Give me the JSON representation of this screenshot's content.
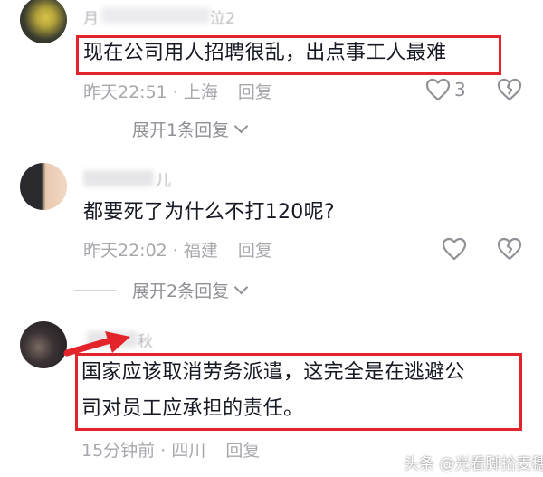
{
  "comments": [
    {
      "name_fragment": "月",
      "name_fragment_2": "泣2",
      "content": "现在公司用人招聘很乱，出点事工人最难",
      "time": "昨天22:51",
      "location": "上海",
      "reply_label": "回复",
      "likes": "3",
      "expand_label": "展开1条回复"
    },
    {
      "name_fragment": "儿",
      "content": "都要死了为什么不打120呢?",
      "time": "昨天22:02",
      "location": "福建",
      "reply_label": "回复",
      "expand_label": "展开2条回复"
    },
    {
      "name_fragment": "秋",
      "content_line1": "国家应该取消劳务派遣，这完全是在逃避公",
      "content_line2": "司对员工应承担的责任。",
      "time": "15分钟前",
      "location": "四川",
      "reply_label": "回复"
    }
  ],
  "separator": " · ",
  "watermark": "头条 @光看脚拾麦穗",
  "colors": {
    "highlight": "#e4242b",
    "meta": "#a7a8ad",
    "text": "#161823"
  },
  "icons": [
    "heart-icon",
    "broken-heart-icon",
    "chevron-down-icon"
  ]
}
